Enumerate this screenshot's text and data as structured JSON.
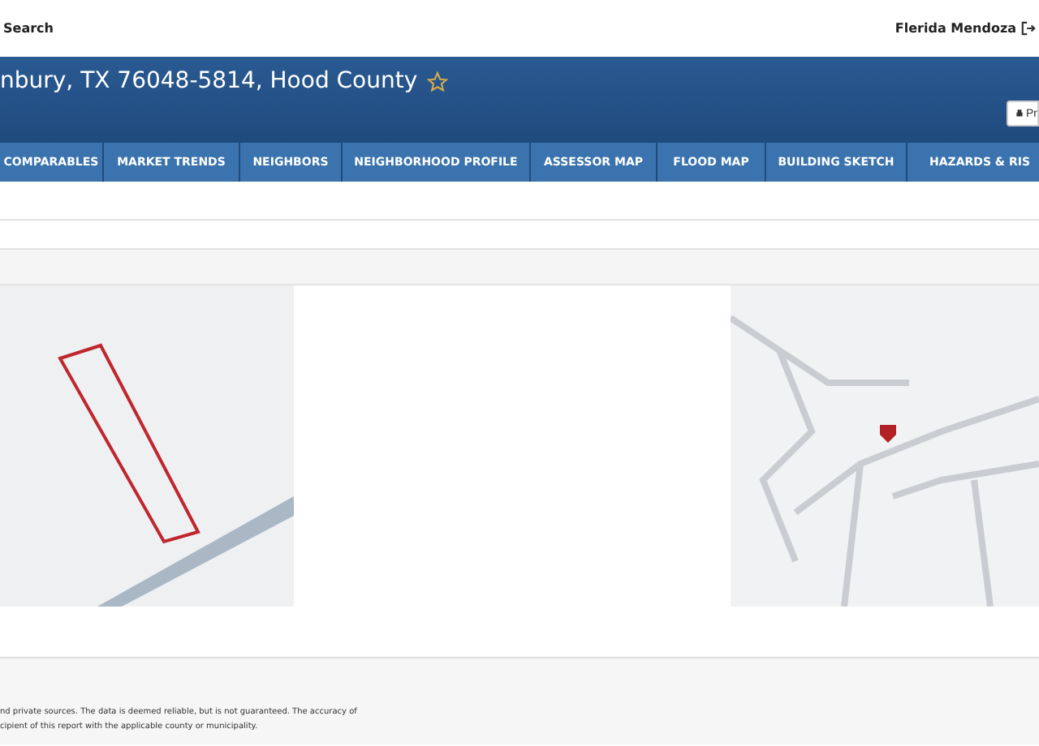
{
  "top_bar": {
    "search_label": "Search",
    "user_name": "Flerida Mendoza"
  },
  "header": {
    "title": "nbury, TX 76048-5814, Hood County",
    "favorite": false,
    "print_button": "Pr"
  },
  "tabs": [
    {
      "label": "COMPARABLES",
      "selected": false
    },
    {
      "label": "MARKET TRENDS",
      "selected": false
    },
    {
      "label": "NEIGHBORS",
      "selected": false
    },
    {
      "label": "NEIGHBORHOOD PROFILE",
      "selected": false
    },
    {
      "label": "ASSESSOR MAP",
      "selected": false
    },
    {
      "label": "FLOOD MAP",
      "selected": false
    },
    {
      "label": "BUILDING SKETCH",
      "selected": false
    },
    {
      "label": "HAZARDS & RIS",
      "selected": false
    }
  ],
  "footer": {
    "lines": [
      "nd private sources. The data is deemed reliable, but is not guaranteed. The accuracy of",
      "cipient of this report with the applicable county or municipality."
    ]
  }
}
